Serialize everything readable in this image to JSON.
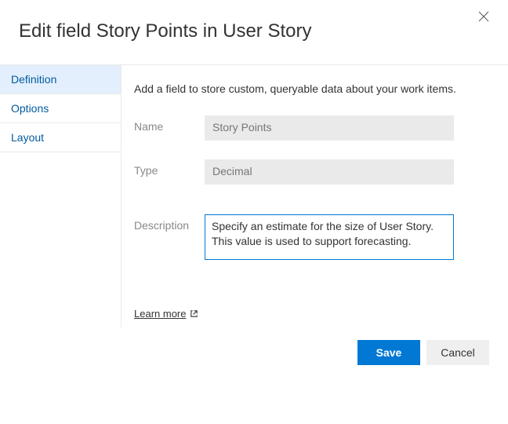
{
  "header": {
    "title": "Edit field Story Points in User Story"
  },
  "sidebar": {
    "tabs": [
      {
        "label": "Definition",
        "active": true
      },
      {
        "label": "Options",
        "active": false
      },
      {
        "label": "Layout",
        "active": false
      }
    ]
  },
  "main": {
    "helper_text": "Add a field to store custom, queryable data about your work items.",
    "name_label": "Name",
    "name_value": "Story Points",
    "type_label": "Type",
    "type_value": "Decimal",
    "description_label": "Description",
    "description_value": "Specify an estimate for the size of User Story. This value is used to support forecasting.",
    "learn_more": "Learn more"
  },
  "footer": {
    "save_label": "Save",
    "cancel_label": "Cancel"
  }
}
